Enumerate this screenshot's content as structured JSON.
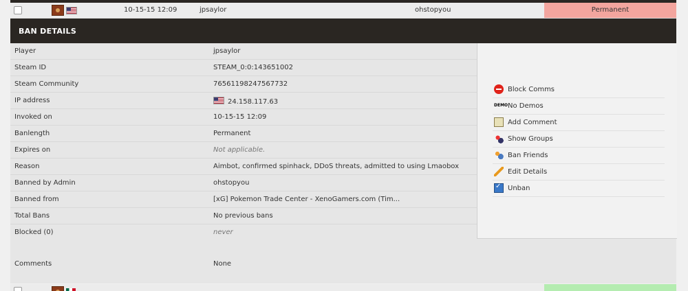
{
  "top_row": {
    "date": "10-15-15 12:09",
    "player": "jpsaylor",
    "admin": "ohstopyou",
    "length": "Permanent",
    "status_color": "#f3a59e"
  },
  "header": {
    "title": "BAN DETAILS"
  },
  "details": [
    {
      "label": "Player",
      "value": "jpsaylor"
    },
    {
      "label": "Steam ID",
      "value": "STEAM_0:0:143651002"
    },
    {
      "label": "Steam Community",
      "value": "76561198247567732"
    },
    {
      "label": "IP address",
      "value": "24.158.117.63"
    },
    {
      "label": "Invoked on",
      "value": "10-15-15 12:09"
    },
    {
      "label": "Banlength",
      "value": "Permanent"
    },
    {
      "label": "Expires on",
      "value": "Not applicable."
    },
    {
      "label": "Reason",
      "value": "Aimbot, confirmed spinhack, DDoS threats, admitted to using Lmaobox"
    },
    {
      "label": "Banned by Admin",
      "value": "ohstopyou"
    },
    {
      "label": "Banned from",
      "value": "[xG] Pokemon Trade Center - XenoGamers.com (Tim..."
    },
    {
      "label": "Total Bans",
      "value": "No previous bans"
    },
    {
      "label": "Blocked (0)",
      "value": "never"
    },
    {
      "label": "Comments",
      "value": "None"
    }
  ],
  "actions": [
    {
      "label": "Block Comms",
      "icon": "block-icon"
    },
    {
      "label": "No Demos",
      "icon": "demo-icon"
    },
    {
      "label": "Add Comment",
      "icon": "comment-icon"
    },
    {
      "label": "Show Groups",
      "icon": "groups-icon"
    },
    {
      "label": "Ban Friends",
      "icon": "friends-icon"
    },
    {
      "label": "Edit Details",
      "icon": "edit-icon"
    },
    {
      "label": "Unban",
      "icon": "unban-icon"
    }
  ],
  "demo_icon_text": "DEMO",
  "bottom_row": {
    "status_color": "#b4ecb0"
  }
}
